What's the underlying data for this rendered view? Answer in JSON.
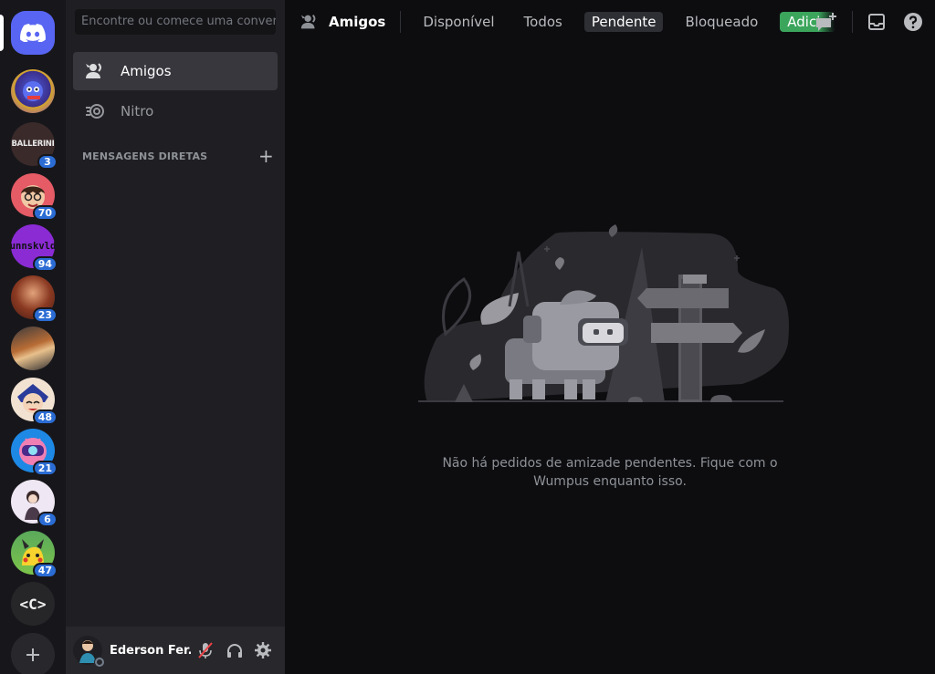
{
  "colors": {
    "accent": "#5865f2",
    "badge": "#2b6cd4",
    "add_friend": "#3ba55c"
  },
  "rail": {
    "home_icon": "discord-logo-icon",
    "servers": [
      {
        "name": "server-1",
        "badge": "",
        "text": ""
      },
      {
        "name": "server-ballerini",
        "badge": "3",
        "text": "BALLERINI"
      },
      {
        "name": "server-3",
        "badge": "70",
        "text": ""
      },
      {
        "name": "server-unnskvld",
        "badge": "94",
        "text": "unnskvld"
      },
      {
        "name": "server-5",
        "badge": "23",
        "text": ""
      },
      {
        "name": "server-6",
        "badge": "",
        "text": ""
      },
      {
        "name": "server-7",
        "badge": "48",
        "text": ""
      },
      {
        "name": "server-8",
        "badge": "21",
        "text": ""
      },
      {
        "name": "server-9",
        "badge": "6",
        "text": ""
      },
      {
        "name": "server-10",
        "badge": "47",
        "text": ""
      },
      {
        "name": "server-c",
        "badge": "",
        "text": "<C>"
      }
    ],
    "add_server_icon": "plus-icon"
  },
  "sidebar": {
    "search_placeholder": "Encontre ou comece uma conversa",
    "nav": [
      {
        "label": "Amigos",
        "icon": "friends-icon"
      },
      {
        "label": "Nitro",
        "icon": "nitro-icon"
      }
    ],
    "dm_header": "MENSAGENS DIRETAS",
    "dm_add": "+",
    "user": {
      "name": "Ederson Fer..."
    }
  },
  "topbar": {
    "title": "Amigos",
    "tabs": [
      "Disponível",
      "Todos",
      "Pendente",
      "Bloqueado"
    ],
    "selected_tab": "Pendente",
    "add_friend": "Adicionar amigo"
  },
  "empty_state": {
    "text": "Não há pedidos de amizade pendentes. Fique com o Wumpus enquanto isso."
  }
}
